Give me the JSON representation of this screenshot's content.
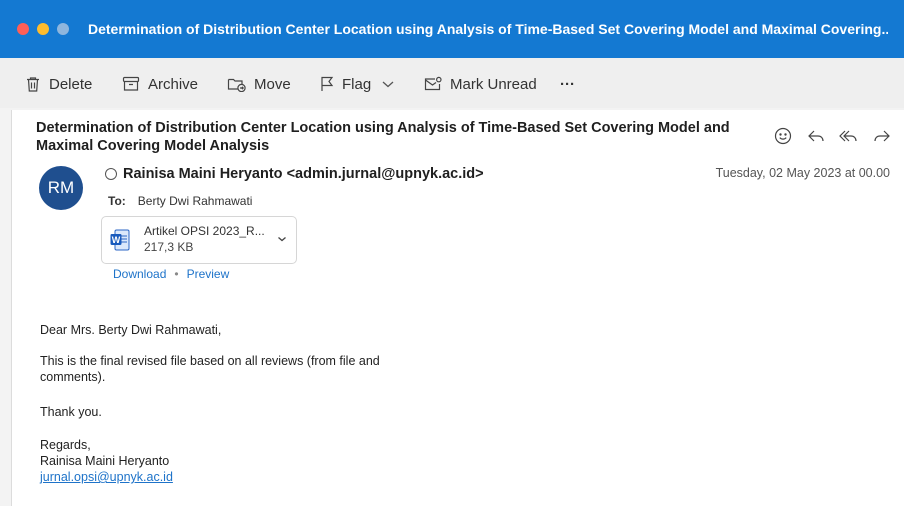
{
  "window": {
    "title": "Determination of Distribution Center Location using Analysis of Time-Based Set Covering Model and Maximal Covering..."
  },
  "toolbar": {
    "delete_label": "Delete",
    "archive_label": "Archive",
    "move_label": "Move",
    "flag_label": "Flag",
    "mark_unread_label": "Mark Unread",
    "more_label": "···"
  },
  "message": {
    "subject_line1": "Determination of Distribution Center Location using Analysis of Time-Based Set Covering Model and",
    "subject_line2": "Maximal Covering Model Analysis",
    "avatar_initials": "RM",
    "sender": "Rainisa Maini Heryanto <admin.jurnal@upnyk.ac.id>",
    "date": "Tuesday, 02 May 2023 at 00.00",
    "to_label": "To:",
    "to_value": "Berty Dwi Rahmawati",
    "attachment": {
      "name": "Artikel OPSI 2023_R...",
      "size": "217,3 KB"
    },
    "download_label": "Download",
    "separator": "•",
    "preview_label": "Preview",
    "body": {
      "greeting": "Dear Mrs. Berty Dwi Rahmawati,",
      "para1_line1": "This is the final revised file based on all reviews (from file and",
      "para1_line2": "comments).",
      "thanks": "Thank you.",
      "regards": "Regards,",
      "signature_name": "Rainisa Maini Heryanto",
      "signature_email": "jurnal.opsi@upnyk.ac.id"
    }
  },
  "colors": {
    "titlebar": "#1479d2",
    "avatar": "#1f4f8f",
    "link": "#1e73c9"
  }
}
